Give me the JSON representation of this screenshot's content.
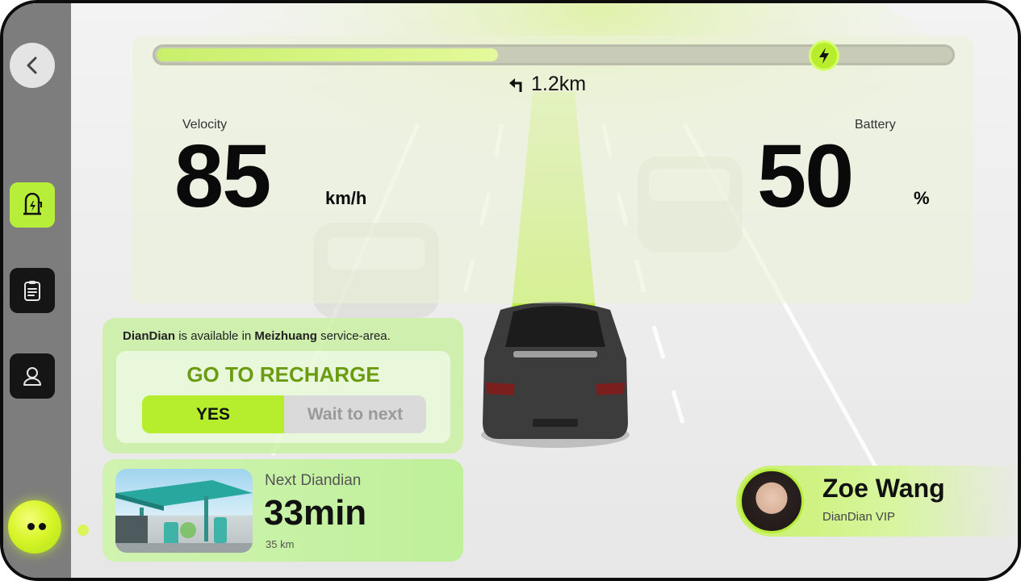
{
  "sidebar": {
    "back_icon": "chevron-left-icon",
    "items": [
      {
        "icon": "charging-station-icon",
        "active": true
      },
      {
        "icon": "clipboard-icon",
        "active": false
      },
      {
        "icon": "user-icon",
        "active": false
      }
    ],
    "assistant_icon": "assistant-face-icon"
  },
  "hud": {
    "charge_progress": 0.43,
    "charge_icon": "lightning-bolt-icon",
    "navigation": {
      "turn_icon": "turn-left-arrow-icon",
      "distance": "1.2km"
    },
    "velocity": {
      "label": "Velocity",
      "value": "85",
      "unit": "km/h"
    },
    "battery": {
      "label": "Battery",
      "value": "50",
      "unit": "%"
    }
  },
  "recharge": {
    "brand": "DianDian",
    "text_available": "is available in",
    "location": "Meizhuang",
    "text_area": "service-area.",
    "title": "GO TO RECHARGE",
    "yes_label": "YES",
    "wait_label": "Wait to next"
  },
  "next_station": {
    "label": "Next Diandian",
    "time": "33min",
    "distance": "35 km"
  },
  "profile": {
    "name": "Zoe Wang",
    "tier": "DianDian VIP"
  },
  "colors": {
    "accent": "#b6ee2e",
    "accent_dark": "#6b9c10",
    "sidebar": "#7d7d7d"
  }
}
